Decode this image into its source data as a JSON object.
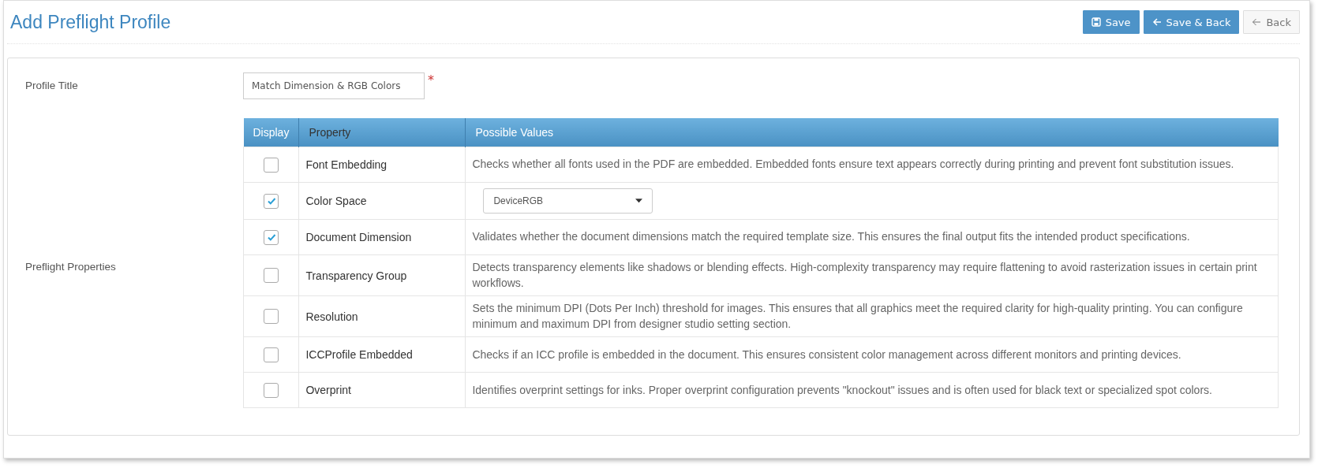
{
  "page": {
    "title": "Add Preflight Profile"
  },
  "buttons": [
    {
      "label": "Save",
      "kind": "primary"
    },
    {
      "label": "Save & Back",
      "kind": "primary"
    },
    {
      "label": "Back",
      "kind": "default"
    }
  ],
  "form": {
    "title_label": "Profile Title",
    "title_value": "Match Dimension & RGB Colors",
    "required_mark": "*",
    "properties_label": "Preflight Properties"
  },
  "table": {
    "columns": [
      "Display",
      "Property",
      "Possible Values"
    ],
    "rows": [
      {
        "checked": false,
        "property": "Font Embedding",
        "kind": "text",
        "value": "Checks whether all fonts used in the PDF are embedded. Embedded fonts ensure text appears correctly during printing and prevent font substitution issues."
      },
      {
        "checked": true,
        "property": "Color Space",
        "kind": "select",
        "value": "DeviceRGB"
      },
      {
        "checked": true,
        "property": "Document Dimension",
        "kind": "text",
        "value": "Validates whether the document dimensions match the required template size. This ensures the final output fits the intended product specifications."
      },
      {
        "checked": false,
        "property": "Transparency Group",
        "kind": "text",
        "value": "Detects transparency elements like shadows or blending effects. High-complexity transparency may require flattening to avoid rasterization issues in certain print workflows."
      },
      {
        "checked": false,
        "property": "Resolution",
        "kind": "text",
        "value": "Sets the minimum DPI (Dots Per Inch) threshold for images. This ensures that all graphics meet the required clarity for high-quality printing. You can configure minimum and maximum DPI from designer studio setting section."
      },
      {
        "checked": false,
        "property": "ICCProfile Embedded",
        "kind": "text",
        "value": "Checks if an ICC profile is embedded in the document. This ensures consistent color management across different monitors and printing devices."
      },
      {
        "checked": false,
        "property": "Overprint",
        "kind": "text",
        "value": "Identifies overprint settings for inks. Proper overprint configuration prevents \"knockout\" issues and is often used for black text or specialized spot colors."
      }
    ]
  }
}
